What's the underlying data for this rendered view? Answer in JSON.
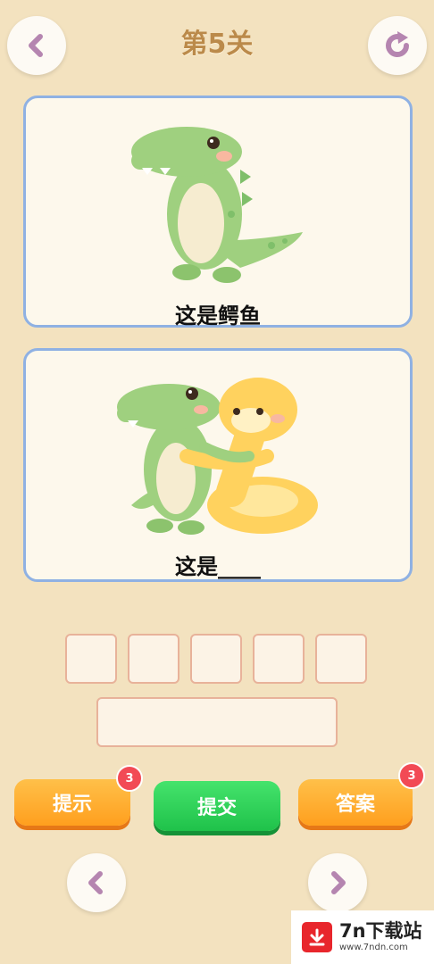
{
  "header": {
    "level_title": "第5关"
  },
  "card1": {
    "caption": "这是鳄鱼"
  },
  "card2": {
    "caption": "这是____"
  },
  "answer": {
    "slots": [
      "",
      "",
      "",
      "",
      ""
    ],
    "input_value": ""
  },
  "actions": {
    "hint_label": "提示",
    "hint_count": "3",
    "submit_label": "提交",
    "answer_label": "答案",
    "answer_count": "3"
  },
  "watermark": {
    "brand": "7n下载站",
    "url": "www.7ndn.com"
  },
  "colors": {
    "background": "#f3e2bf",
    "card_border": "#8fb1e3",
    "orange": "#ff9f1e",
    "green": "#1fc24a",
    "icon": "#b585b0"
  }
}
